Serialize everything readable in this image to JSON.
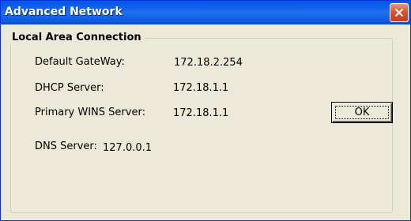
{
  "window": {
    "title": "Advanced Network",
    "close_icon": "close-icon"
  },
  "group": {
    "title": "Local Area Connection"
  },
  "fields": {
    "gateway_label": "Default GateWay:",
    "gateway_value": "172.18.2.254",
    "dhcp_label": "DHCP Server:",
    "dhcp_value": "172.18.1.1",
    "wins_label": "Primary WINS Server:",
    "wins_value": "172.18.1.1",
    "dns_label": "DNS Server:",
    "dns_value": "127.0.0.1"
  },
  "buttons": {
    "ok_label": "OK"
  },
  "colors": {
    "titlebar": "#0a5ce6",
    "close": "#d8552f",
    "background": "#ece9d8"
  }
}
